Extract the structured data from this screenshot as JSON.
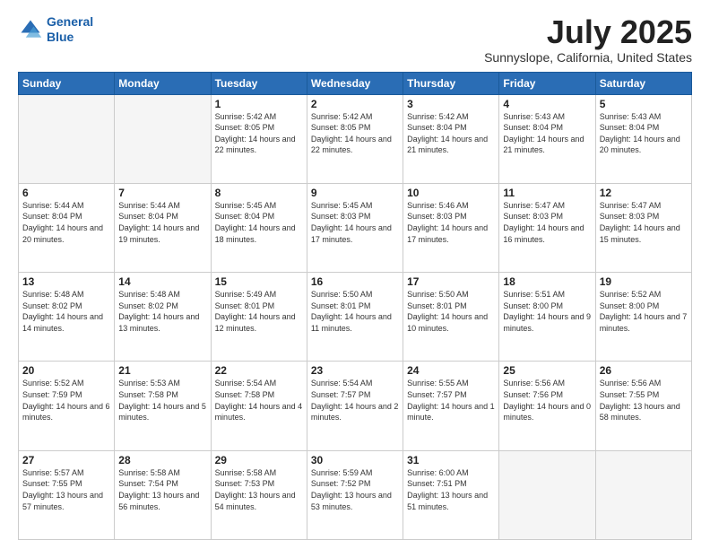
{
  "logo": {
    "text_line1": "General",
    "text_line2": "Blue"
  },
  "title": "July 2025",
  "location": "Sunnyslope, California, United States",
  "days_of_week": [
    "Sunday",
    "Monday",
    "Tuesday",
    "Wednesday",
    "Thursday",
    "Friday",
    "Saturday"
  ],
  "weeks": [
    [
      {
        "day": "",
        "empty": true
      },
      {
        "day": "",
        "empty": true
      },
      {
        "day": "1",
        "sunrise": "5:42 AM",
        "sunset": "8:05 PM",
        "daylight": "14 hours and 22 minutes."
      },
      {
        "day": "2",
        "sunrise": "5:42 AM",
        "sunset": "8:05 PM",
        "daylight": "14 hours and 22 minutes."
      },
      {
        "day": "3",
        "sunrise": "5:42 AM",
        "sunset": "8:04 PM",
        "daylight": "14 hours and 21 minutes."
      },
      {
        "day": "4",
        "sunrise": "5:43 AM",
        "sunset": "8:04 PM",
        "daylight": "14 hours and 21 minutes."
      },
      {
        "day": "5",
        "sunrise": "5:43 AM",
        "sunset": "8:04 PM",
        "daylight": "14 hours and 20 minutes."
      }
    ],
    [
      {
        "day": "6",
        "sunrise": "5:44 AM",
        "sunset": "8:04 PM",
        "daylight": "14 hours and 20 minutes."
      },
      {
        "day": "7",
        "sunrise": "5:44 AM",
        "sunset": "8:04 PM",
        "daylight": "14 hours and 19 minutes."
      },
      {
        "day": "8",
        "sunrise": "5:45 AM",
        "sunset": "8:04 PM",
        "daylight": "14 hours and 18 minutes."
      },
      {
        "day": "9",
        "sunrise": "5:45 AM",
        "sunset": "8:03 PM",
        "daylight": "14 hours and 17 minutes."
      },
      {
        "day": "10",
        "sunrise": "5:46 AM",
        "sunset": "8:03 PM",
        "daylight": "14 hours and 17 minutes."
      },
      {
        "day": "11",
        "sunrise": "5:47 AM",
        "sunset": "8:03 PM",
        "daylight": "14 hours and 16 minutes."
      },
      {
        "day": "12",
        "sunrise": "5:47 AM",
        "sunset": "8:03 PM",
        "daylight": "14 hours and 15 minutes."
      }
    ],
    [
      {
        "day": "13",
        "sunrise": "5:48 AM",
        "sunset": "8:02 PM",
        "daylight": "14 hours and 14 minutes."
      },
      {
        "day": "14",
        "sunrise": "5:48 AM",
        "sunset": "8:02 PM",
        "daylight": "14 hours and 13 minutes."
      },
      {
        "day": "15",
        "sunrise": "5:49 AM",
        "sunset": "8:01 PM",
        "daylight": "14 hours and 12 minutes."
      },
      {
        "day": "16",
        "sunrise": "5:50 AM",
        "sunset": "8:01 PM",
        "daylight": "14 hours and 11 minutes."
      },
      {
        "day": "17",
        "sunrise": "5:50 AM",
        "sunset": "8:01 PM",
        "daylight": "14 hours and 10 minutes."
      },
      {
        "day": "18",
        "sunrise": "5:51 AM",
        "sunset": "8:00 PM",
        "daylight": "14 hours and 9 minutes."
      },
      {
        "day": "19",
        "sunrise": "5:52 AM",
        "sunset": "8:00 PM",
        "daylight": "14 hours and 7 minutes."
      }
    ],
    [
      {
        "day": "20",
        "sunrise": "5:52 AM",
        "sunset": "7:59 PM",
        "daylight": "14 hours and 6 minutes."
      },
      {
        "day": "21",
        "sunrise": "5:53 AM",
        "sunset": "7:58 PM",
        "daylight": "14 hours and 5 minutes."
      },
      {
        "day": "22",
        "sunrise": "5:54 AM",
        "sunset": "7:58 PM",
        "daylight": "14 hours and 4 minutes."
      },
      {
        "day": "23",
        "sunrise": "5:54 AM",
        "sunset": "7:57 PM",
        "daylight": "14 hours and 2 minutes."
      },
      {
        "day": "24",
        "sunrise": "5:55 AM",
        "sunset": "7:57 PM",
        "daylight": "14 hours and 1 minute."
      },
      {
        "day": "25",
        "sunrise": "5:56 AM",
        "sunset": "7:56 PM",
        "daylight": "14 hours and 0 minutes."
      },
      {
        "day": "26",
        "sunrise": "5:56 AM",
        "sunset": "7:55 PM",
        "daylight": "13 hours and 58 minutes."
      }
    ],
    [
      {
        "day": "27",
        "sunrise": "5:57 AM",
        "sunset": "7:55 PM",
        "daylight": "13 hours and 57 minutes."
      },
      {
        "day": "28",
        "sunrise": "5:58 AM",
        "sunset": "7:54 PM",
        "daylight": "13 hours and 56 minutes."
      },
      {
        "day": "29",
        "sunrise": "5:58 AM",
        "sunset": "7:53 PM",
        "daylight": "13 hours and 54 minutes."
      },
      {
        "day": "30",
        "sunrise": "5:59 AM",
        "sunset": "7:52 PM",
        "daylight": "13 hours and 53 minutes."
      },
      {
        "day": "31",
        "sunrise": "6:00 AM",
        "sunset": "7:51 PM",
        "daylight": "13 hours and 51 minutes."
      },
      {
        "day": "",
        "empty": true
      },
      {
        "day": "",
        "empty": true
      }
    ]
  ]
}
